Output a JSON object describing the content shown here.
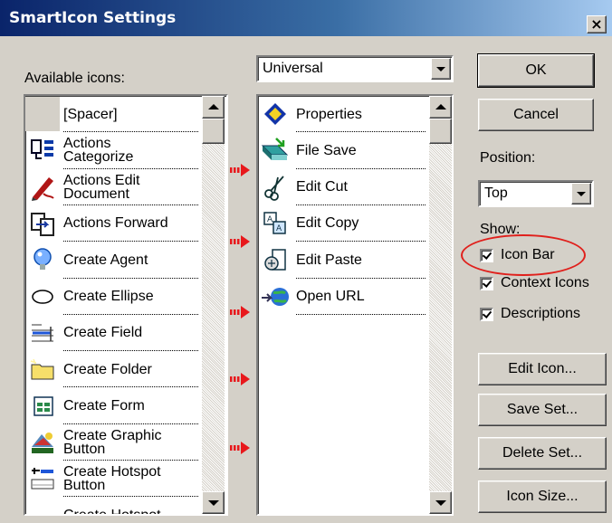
{
  "window": {
    "title": "SmartIcon Settings",
    "close_label": "×"
  },
  "available": {
    "label": "Available icons:",
    "items": [
      {
        "label": "[Spacer]",
        "icon": "spacer-icon"
      },
      {
        "label": "Actions\nCategorize",
        "icon": "actions-categorize-icon"
      },
      {
        "label": "Actions Edit\nDocument",
        "icon": "actions-edit-document-icon"
      },
      {
        "label": "Actions Forward",
        "icon": "actions-forward-icon"
      },
      {
        "label": "Create Agent",
        "icon": "create-agent-icon"
      },
      {
        "label": "Create Ellipse",
        "icon": "create-ellipse-icon"
      },
      {
        "label": "Create Field",
        "icon": "create-field-icon"
      },
      {
        "label": "Create Folder",
        "icon": "create-folder-icon"
      },
      {
        "label": "Create Form",
        "icon": "create-form-icon"
      },
      {
        "label": "Create Graphic\nButton",
        "icon": "create-graphic-button-icon"
      },
      {
        "label": "Create Hotspot\nButton",
        "icon": "create-hotspot-button-icon"
      },
      {
        "label": "Create Hotspot",
        "icon": "create-hotspot-icon"
      }
    ]
  },
  "set": {
    "selected": "Universal",
    "items": [
      {
        "label": "Properties",
        "icon": "properties-icon"
      },
      {
        "label": "File Save",
        "icon": "file-save-icon"
      },
      {
        "label": "Edit Cut",
        "icon": "edit-cut-icon"
      },
      {
        "label": "Edit Copy",
        "icon": "edit-copy-icon"
      },
      {
        "label": "Edit Paste",
        "icon": "edit-paste-icon"
      },
      {
        "label": "Open URL",
        "icon": "open-url-icon"
      }
    ]
  },
  "buttons": {
    "ok": "OK",
    "cancel": "Cancel",
    "edit_icon": "Edit Icon...",
    "save_set": "Save Set...",
    "delete_set": "Delete Set...",
    "icon_size": "Icon Size..."
  },
  "position": {
    "label": "Position:",
    "value": "Top"
  },
  "show": {
    "label": "Show:",
    "options": [
      {
        "label": "Icon Bar",
        "checked": true
      },
      {
        "label": "Context Icons",
        "checked": true
      },
      {
        "label": "Descriptions",
        "checked": true
      }
    ]
  },
  "colors": {
    "highlight": "#e0201c",
    "arrow": "#e8181c",
    "titlebar": "#0a246a"
  }
}
